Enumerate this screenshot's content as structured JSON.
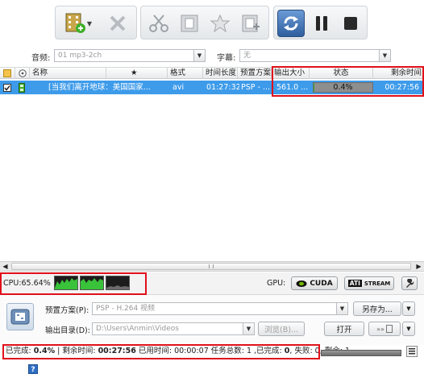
{
  "settings": {
    "audio_label": "音频:",
    "audio_value": "01 mp3-2ch",
    "subtitle_label": "字幕:",
    "subtitle_value": "无"
  },
  "table": {
    "columns": [
      "名称",
      "★",
      "格式",
      "时间长度",
      "预置方案",
      "输出大小",
      "状态",
      "剩余时间"
    ],
    "rows": [
      {
        "checked": true,
        "name": "[当我们离开地球：美国国家...",
        "format": "avi",
        "duration": "01:27:32",
        "preset": "PSP - ...",
        "output_size": "561.0 ...",
        "progress_percent": 0.4,
        "status": "0.4%",
        "remaining": "00:27:56"
      }
    ]
  },
  "cpu": {
    "label": "CPU:65.64%"
  },
  "gpu": {
    "label": "GPU:",
    "cuda": "CUDA",
    "ati": "ATI",
    "stream": "STREAM"
  },
  "output": {
    "preset_label": "预置方案(P):",
    "preset_value": "PSP - H.264 视频",
    "saveas_button": "另存为...",
    "dir_label": "输出目录(D):",
    "dir_value": "D:\\Users\\Anmin\\Videos",
    "browse_button": "浏览(B)...",
    "open_button": "打开"
  },
  "status": {
    "completed_label": "已完成: ",
    "completed_value": "0.4%",
    "remaining_label": " | 剩余时间: ",
    "remaining_value": "00:27:56",
    "rest": " 已用时间: 00:00:07 任务总数: 1 ,已完成: ",
    "done_value": "0",
    "failed_label": ", 失败: 0, 剩余: 1"
  },
  "help": "?"
}
